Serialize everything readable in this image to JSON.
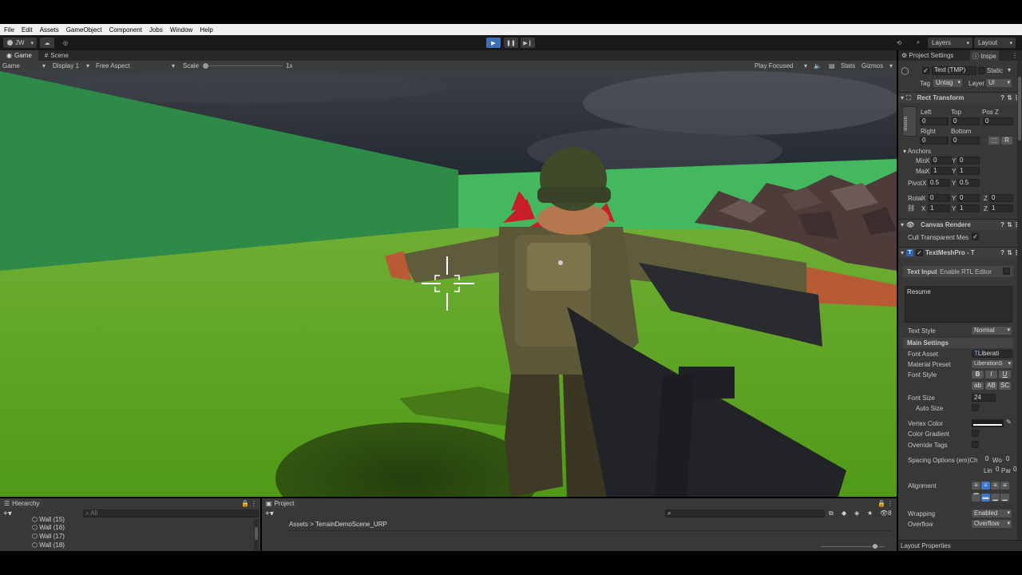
{
  "menu": [
    "File",
    "Edit",
    "Assets",
    "GameObject",
    "Component",
    "Jobs",
    "Window",
    "Help"
  ],
  "toolbar": {
    "account": "JW",
    "layers": "Layers",
    "layout": "Layout"
  },
  "game_view": {
    "tabs": [
      "Game",
      "Scene"
    ],
    "display_mode": "Game",
    "display": "Display 1",
    "aspect": "Free Aspect",
    "scale_label": "Scale",
    "scale_value": "1x",
    "play_mode": "Play Focused",
    "stats": "Stats",
    "gizmos": "Gizmos"
  },
  "inspector": {
    "tabs": [
      "Project Settings",
      "Inspe"
    ],
    "object_name": "Text (TMP)",
    "static_label": "Static",
    "tag_label": "Tag",
    "tag_value": "Untag",
    "layer_label": "Layer",
    "layer_value": "UI",
    "rect_transform": {
      "title": "Rect Transform",
      "stretch_label": "stretch",
      "left_label": "Left",
      "top_label": "Top",
      "posz_label": "Pos Z",
      "left": "0",
      "top": "0",
      "posz": "0",
      "right_label": "Right",
      "bottom_label": "Bottom",
      "right": "0",
      "bottom": "0",
      "anchors_label": "Anchors",
      "min_label": "Min",
      "min_x": "0",
      "min_y": "0",
      "max_label": "Max",
      "max_x": "1",
      "max_y": "1",
      "pivot_label": "Pivot",
      "pivot_x": "0.5",
      "pivot_y": "0.5",
      "rotation_label": "Rotation",
      "rot_x": "0",
      "rot_y": "0",
      "rot_z": "0",
      "scale_x": "1",
      "scale_y": "1",
      "scale_z": "1",
      "x": "X",
      "y": "Y",
      "z": "Z",
      "r": "R"
    },
    "canvas_renderer": {
      "title": "Canvas Rendere",
      "cull_label": "Cull Transparent Mes"
    },
    "textmeshpro": {
      "title": "TextMeshPro - T",
      "text_input_label": "Text Input",
      "rtl_label": "Enable RTL Editor",
      "text_value": "Resume",
      "text_style_label": "Text Style",
      "text_style_value": "Normal",
      "main_settings_label": "Main Settings",
      "font_asset_label": "Font Asset",
      "font_asset_value": "Liberati",
      "material_preset_label": "Material Preset",
      "material_preset_value": "LiberationS",
      "font_style_label": "Font Style",
      "style_buttons_row1": [
        "B",
        "I",
        "U"
      ],
      "style_buttons_row2": [
        "ab",
        "AB",
        "SC"
      ],
      "font_size_label": "Font Size",
      "font_size_value": "24",
      "auto_size_label": "Auto Size",
      "vertex_color_label": "Vertex Color",
      "color_gradient_label": "Color Gradient",
      "override_tags_label": "Override Tags",
      "spacing_label": "Spacing Options (em)",
      "spacing_char": "Ch",
      "spacing_char_value": "0",
      "spacing_word": "Wo",
      "spacing_word_value": "0",
      "spacing_line": "Lin",
      "spacing_line_value": "0",
      "spacing_para": "Par",
      "spacing_para_value": "0",
      "alignment_label": "Alignment",
      "wrapping_label": "Wrapping",
      "wrapping_value": "Enabled",
      "overflow_label": "Overflow",
      "overflow_value": "Overflow"
    },
    "layout_properties": "Layout Properties",
    "colors": {
      "checkbox_blue": "#3a78c8",
      "accent_blue": "#2f65b0"
    }
  },
  "hierarchy": {
    "tab": "Hierarchy",
    "search_placeholder": "All",
    "items": [
      "Wall (15)",
      "Wall (16)",
      "Wall (17)",
      "Wall (18)"
    ]
  },
  "project": {
    "tab": "Project",
    "breadcrumb_root": "Assets",
    "breadcrumb_child": "TerrainDemoScene_URP",
    "count": "8"
  },
  "scene_colors": {
    "sky": "#2a3038",
    "wall_left": "#2e8b47",
    "wall_right": "#43b85f",
    "ground": "#62a52a",
    "uniform": "#5f5c3b",
    "helmet": "#3f4a2a"
  }
}
